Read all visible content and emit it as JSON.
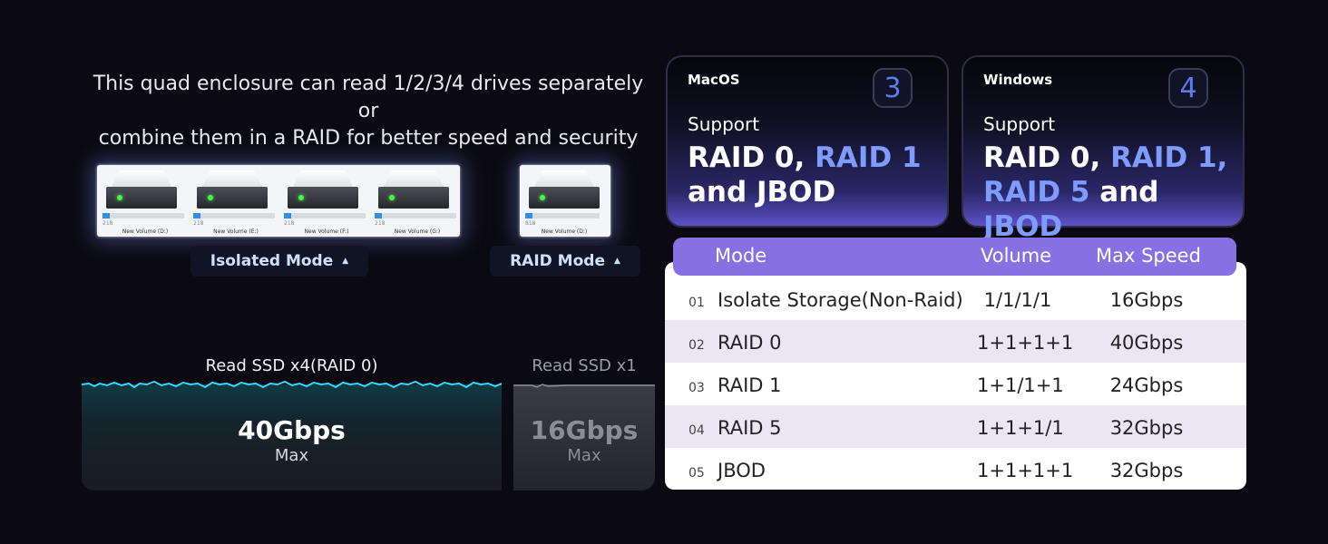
{
  "intro_text": {
    "line1": "This quad enclosure can read 1/2/3/4 drives separately or",
    "line2": "combine them in a RAID for better speed and security"
  },
  "isolated_drives": [
    {
      "cap": "218",
      "label": "New Volume (D:)"
    },
    {
      "cap": "218",
      "label": "New Volume (E:)"
    },
    {
      "cap": "218",
      "label": "New Volume (F:)"
    },
    {
      "cap": "218",
      "label": "New Volume (G:)"
    }
  ],
  "raid_drive": {
    "cap": "818",
    "label": "New Volume (D:)"
  },
  "modes": {
    "isolated": "Isolated Mode",
    "raid": "RAID Mode",
    "caret": "▲"
  },
  "speeds": {
    "raid": {
      "label": "Read SSD x4(RAID 0)",
      "value": "40Gbps",
      "max": "Max"
    },
    "single": {
      "label": "Read SSD x1",
      "value": "16Gbps",
      "max": "Max"
    }
  },
  "os_cards": {
    "mac": {
      "name": "MacOS",
      "num": "3",
      "support": "Support",
      "line1_a": "RAID 0, ",
      "line1_b": "RAID 1",
      "line2": "and JBOD"
    },
    "win": {
      "name": "Windows",
      "num": "4",
      "support": "Support",
      "line1_a": "RAID 0, ",
      "line1_b": "RAID 1,",
      "line2_a": "RAID 5",
      "line2_b": " and ",
      "line2_c": "JBOD"
    }
  },
  "table": {
    "headers": {
      "mode": "Mode",
      "volume": "Volume",
      "speed": "Max Speed"
    },
    "rows": [
      {
        "idx": "01",
        "mode": "Isolate Storage(Non-Raid)",
        "volume": "1/1/1/1",
        "speed": "16Gbps"
      },
      {
        "idx": "02",
        "mode": "RAID 0",
        "volume": "1+1+1+1",
        "speed": "40Gbps"
      },
      {
        "idx": "03",
        "mode": "RAID 1",
        "volume": "1+1/1+1",
        "speed": "24Gbps"
      },
      {
        "idx": "04",
        "mode": "RAID 5",
        "volume": "1+1+1/1",
        "speed": "32Gbps"
      },
      {
        "idx": "05",
        "mode": "JBOD",
        "volume": "1+1+1+1",
        "speed": "32Gbps"
      }
    ]
  },
  "colors": {
    "accent": "#8671e3",
    "highlight": "#7e9bff",
    "wave": "#35d6ff"
  }
}
